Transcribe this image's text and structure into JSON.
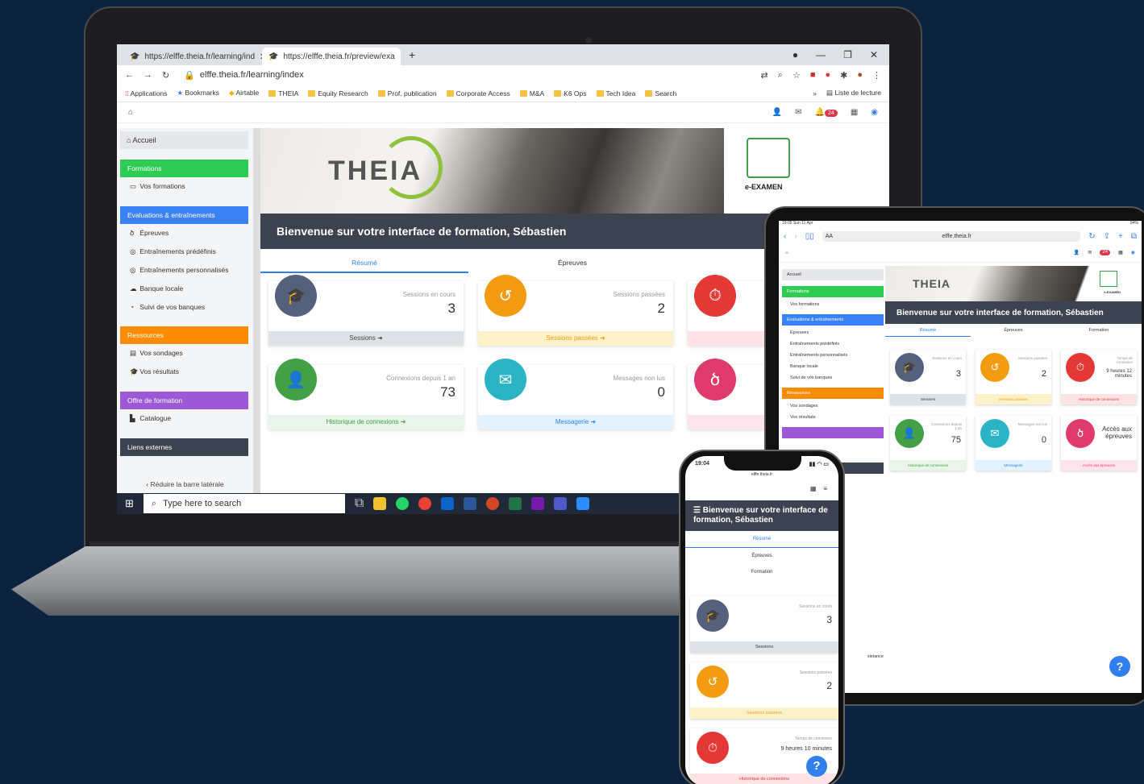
{
  "colors": {
    "background": "#0c2340",
    "green": "#2ecc52",
    "blue": "#3b82f6",
    "orange": "#fb8c00",
    "purple": "#9b59d6",
    "dark": "#3c4350",
    "accent": "#2f80ed",
    "slate": "#55607a",
    "amber": "#f39c12",
    "red": "#e53935",
    "teal": "#2bb3c6",
    "pink": "#e03b6e"
  },
  "laptop": {
    "browser": {
      "tab1": "https://elffe.theia.fr/learning/ind",
      "tab2": "https://elffe.theia.fr/preview/exa",
      "url": "elffe.theia.fr/learning/index",
      "bookmarks": [
        "Applications",
        "Bookmarks",
        "Airtable",
        "THEIA",
        "Equity Research",
        "Prof. publication",
        "Corporate Access",
        "M&A",
        "K6 Ops",
        "Tech Idea",
        "Search"
      ],
      "reading_list": "Liste de lecture",
      "more": "»"
    },
    "notifications": "24",
    "sidebar": {
      "home": "Accueil",
      "sections": [
        {
          "title": "Formations",
          "items": [
            "Vos formations"
          ]
        },
        {
          "title": "Evaluations & entraînements",
          "items": [
            "Épreuves",
            "Entraînements prédéfinis",
            "Entraînements personnalisés",
            "Banque locale",
            "Suivi de vos banques"
          ]
        },
        {
          "title": "Ressources",
          "items": [
            "Vos sondages",
            "Vos résultats"
          ]
        },
        {
          "title": "Offre de formation",
          "items": [
            "Catalogue"
          ]
        },
        {
          "title": "Liens externes",
          "items": []
        }
      ],
      "collapse": "Réduire la barre latérale"
    },
    "logo": "THEIA",
    "exam_label": "e-EXAMEN",
    "welcome": "Bienvenue sur votre interface de formation, Sébastien",
    "tabs": [
      "Résumé",
      "Épreuves"
    ],
    "cards": [
      {
        "label": "Sessions en cours",
        "value": "3",
        "footer": "Sessions"
      },
      {
        "label": "Sessions passées",
        "value": "2",
        "footer": "Sessions passées"
      },
      {
        "label": "",
        "value": "",
        "footer": "Histori"
      },
      {
        "label": "Connexions depuis 1 an",
        "value": "73",
        "footer": "Historique de connexions"
      },
      {
        "label": "Messages non lus",
        "value": "0",
        "footer": "Messagerie"
      },
      {
        "label": "",
        "value": "",
        "footer": "Acc"
      }
    ],
    "taskbar_search": "Type here to search"
  },
  "tablet": {
    "status_time": "19:05 Sun 11 Apr",
    "battery": "84%",
    "aa": "AA",
    "url": "elffe.theia.fr",
    "notifications": "24",
    "sidebar": [
      "Accueil",
      "Formations",
      "Vos formations",
      "Evaluations & entraînements",
      "Épreuves",
      "Entraînements prédéfinis",
      "Entraînements personnalisés",
      "Banque locale",
      "Suivi de vos banques",
      "Ressources",
      "Vos sondages",
      "Vos résultats"
    ],
    "sidebar_frag": "sistance",
    "logo": "THEIA",
    "exam_label": "e-EXAMEN",
    "welcome": "Bienvenue sur votre interface de formation, Sébastien",
    "tabs": [
      "Résumé",
      "Épreuves",
      "Formation"
    ],
    "cards": [
      {
        "label": "Sessions en cours",
        "value": "3",
        "footer": "Sessions"
      },
      {
        "label": "Sessions passées",
        "value": "2",
        "footer": "Sessions passées"
      },
      {
        "label": "Temps de connexion",
        "value": "9 heures 12 minutes",
        "footer": "Historique de connexions"
      },
      {
        "label": "Connexions depuis 1 an",
        "value": "75",
        "footer": "Historique de connexions"
      },
      {
        "label": "Messages non lus",
        "value": "0",
        "footer": "Messagerie"
      },
      {
        "label": "",
        "value": "Accès aux épreuves",
        "footer": "Accès aux épreuves"
      }
    ],
    "help": "?"
  },
  "phone": {
    "time": "19:04",
    "url": "elffe.theia.fr",
    "welcome": "☰ Bienvenue sur votre interface de formation, Sébastien",
    "tabs": [
      "Résumé",
      "Épreuves",
      "Formation"
    ],
    "cards": [
      {
        "label": "Sessions en cours",
        "value": "3",
        "footer": "Sessions"
      },
      {
        "label": "Sessions passées",
        "value": "2",
        "footer": "Sessions passées"
      },
      {
        "label": "Temps de connexion",
        "value": "9 heures 10 minutes",
        "footer": "Historique de connexions"
      }
    ],
    "help": "?"
  }
}
